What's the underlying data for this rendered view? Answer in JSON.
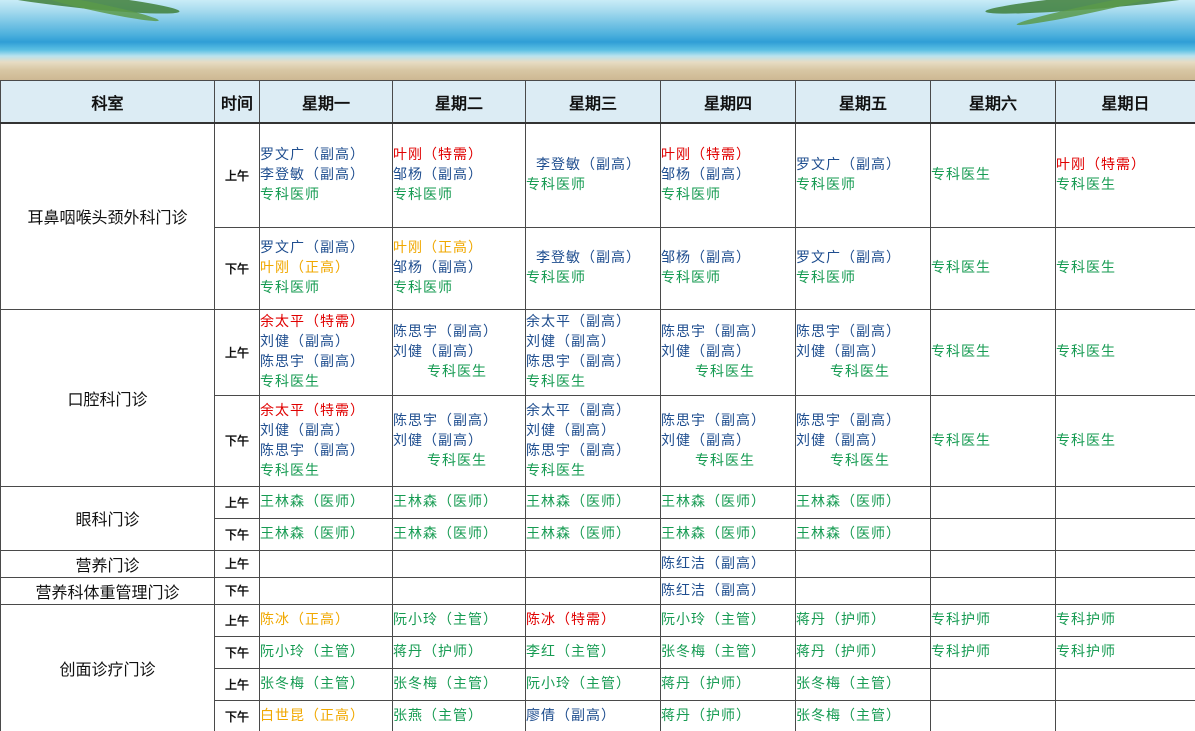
{
  "colors": {
    "blue": "#1f4e8f",
    "red": "#e00000",
    "orange": "#f0a800",
    "green": "#169b52",
    "header_bg": "#dcecf4"
  },
  "header": [
    "科室",
    "时间",
    "星期一",
    "星期二",
    "星期三",
    "星期四",
    "星期五",
    "星期六",
    "星期日"
  ],
  "rows": [
    {
      "dept": "耳鼻咽喉头颈外科门诊",
      "dept_rowspan": 2,
      "period": "上午",
      "height": 104,
      "cells": [
        [
          [
            "罗文广（副高）",
            "blue"
          ],
          [
            "李登敏（副高）",
            "blue"
          ],
          [
            "专科医师",
            "green"
          ]
        ],
        [
          [
            "叶刚（特需）",
            "red"
          ],
          [
            "邹杨（副高）",
            "blue"
          ],
          [
            "专科医师",
            "green"
          ]
        ],
        [
          [
            "李登敏（副高）",
            "blue",
            "ind"
          ],
          [
            "专科医师",
            "green"
          ]
        ],
        [
          [
            "叶刚（特需）",
            "red"
          ],
          [
            "邹杨（副高）",
            "blue"
          ],
          [
            "专科医师",
            "green"
          ]
        ],
        [
          [
            "罗文广（副高）",
            "blue"
          ],
          [
            "专科医师",
            "green"
          ]
        ],
        [
          [
            "专科医生",
            "green"
          ]
        ],
        [
          [
            "叶刚（特需）",
            "red"
          ],
          [
            "专科医生",
            "green"
          ]
        ]
      ]
    },
    {
      "period": "下午",
      "height": 82,
      "cells": [
        [
          [
            "罗文广（副高）",
            "blue"
          ],
          [
            "叶刚（正高）",
            "orange"
          ],
          [
            "专科医师",
            "green"
          ]
        ],
        [
          [
            "叶刚（正高）",
            "orange"
          ],
          [
            "邹杨（副高）",
            "blue"
          ],
          [
            "专科医师",
            "green"
          ]
        ],
        [
          [
            "李登敏（副高）",
            "blue",
            "ind"
          ],
          [
            "专科医师",
            "green"
          ]
        ],
        [
          [
            "邹杨（副高）",
            "blue"
          ],
          [
            "专科医师",
            "green"
          ]
        ],
        [
          [
            "罗文广（副高）",
            "blue"
          ],
          [
            "专科医师",
            "green"
          ]
        ],
        [
          [
            "专科医生",
            "green"
          ]
        ],
        [
          [
            "专科医生",
            "green"
          ]
        ]
      ]
    },
    {
      "dept": "口腔科门诊",
      "dept_rowspan": 2,
      "period": "上午",
      "height": 86,
      "cells": [
        [
          [
            "余太平（特需）",
            "red"
          ],
          [
            "刘健（副高）",
            "blue"
          ],
          [
            "陈思宇（副高）",
            "blue"
          ],
          [
            "专科医生",
            "green"
          ]
        ],
        [
          [
            "陈思宇（副高）",
            "blue"
          ],
          [
            "刘健（副高）",
            "blue"
          ],
          [
            "专科医生",
            "green",
            "ind2"
          ]
        ],
        [
          [
            "余太平（副高）",
            "blue"
          ],
          [
            "刘健（副高）",
            "blue"
          ],
          [
            "陈思宇（副高）",
            "blue"
          ],
          [
            "专科医生",
            "green"
          ]
        ],
        [
          [
            "陈思宇（副高）",
            "blue"
          ],
          [
            "刘健（副高）",
            "blue"
          ],
          [
            "专科医生",
            "green",
            "ind2"
          ]
        ],
        [
          [
            "陈思宇（副高）",
            "blue"
          ],
          [
            "刘健（副高）",
            "blue"
          ],
          [
            "专科医生",
            "green",
            "ind2"
          ]
        ],
        [
          [
            "专科医生",
            "green"
          ]
        ],
        [
          [
            "专科医生",
            "green"
          ]
        ]
      ]
    },
    {
      "period": "下午",
      "height": 91,
      "cells": [
        [
          [
            "余太平（特需）",
            "red"
          ],
          [
            "刘健（副高）",
            "blue"
          ],
          [
            "陈思宇（副高）",
            "blue"
          ],
          [
            "专科医生",
            "green"
          ]
        ],
        [
          [
            "陈思宇（副高）",
            "blue"
          ],
          [
            "刘健（副高）",
            "blue"
          ],
          [
            "专科医生",
            "green",
            "ind2"
          ]
        ],
        [
          [
            "余太平（副高）",
            "blue"
          ],
          [
            "刘健（副高）",
            "blue"
          ],
          [
            "陈思宇（副高）",
            "blue"
          ],
          [
            "专科医生",
            "green"
          ]
        ],
        [
          [
            "陈思宇（副高）",
            "blue"
          ],
          [
            "刘健（副高）",
            "blue"
          ],
          [
            "专科医生",
            "green",
            "ind2"
          ]
        ],
        [
          [
            "陈思宇（副高）",
            "blue"
          ],
          [
            "刘健（副高）",
            "blue"
          ],
          [
            "专科医生",
            "green",
            "ind2"
          ]
        ],
        [
          [
            "专科医生",
            "green"
          ]
        ],
        [
          [
            "专科医生",
            "green"
          ]
        ]
      ]
    },
    {
      "dept": "眼科门诊",
      "dept_rowspan": 2,
      "period": "上午",
      "height": 32,
      "cells": [
        [
          [
            "王林森（医师）",
            "green"
          ]
        ],
        [
          [
            "王林森（医师）",
            "green"
          ]
        ],
        [
          [
            "王林森（医师）",
            "green"
          ]
        ],
        [
          [
            "王林森（医师）",
            "green"
          ]
        ],
        [
          [
            "王林森（医师）",
            "green"
          ]
        ],
        [],
        []
      ]
    },
    {
      "period": "下午",
      "height": 32,
      "cells": [
        [
          [
            "王林森（医师）",
            "green"
          ]
        ],
        [
          [
            "王林森（医师）",
            "green"
          ]
        ],
        [
          [
            "王林森（医师）",
            "green"
          ]
        ],
        [
          [
            "王林森（医师）",
            "green"
          ]
        ],
        [
          [
            "王林森（医师）",
            "green"
          ]
        ],
        [],
        []
      ]
    },
    {
      "dept": "营养门诊",
      "dept_rowspan": 1,
      "period": "上午",
      "height": 27,
      "cells": [
        [],
        [],
        [],
        [
          [
            "陈红洁（副高）",
            "blue"
          ]
        ],
        [],
        [],
        []
      ]
    },
    {
      "dept": "营养科体重管理门诊",
      "dept_rowspan": 1,
      "period": "下午",
      "height": 27,
      "cells": [
        [],
        [],
        [],
        [
          [
            "陈红洁（副高）",
            "blue"
          ]
        ],
        [],
        [],
        []
      ]
    },
    {
      "dept": "创面诊疗门诊",
      "dept_rowspan": 4,
      "period": "上午",
      "height": 32,
      "cells": [
        [
          [
            "陈冰（正高）",
            "orange"
          ]
        ],
        [
          [
            "阮小玲（主管）",
            "green"
          ]
        ],
        [
          [
            "陈冰（特需）",
            "red"
          ]
        ],
        [
          [
            "阮小玲（主管）",
            "green"
          ]
        ],
        [
          [
            "蒋丹（护师）",
            "green"
          ]
        ],
        [
          [
            "专科护师",
            "green"
          ]
        ],
        [
          [
            "专科护师",
            "green"
          ]
        ]
      ]
    },
    {
      "period": "下午",
      "height": 32,
      "cells": [
        [
          [
            "阮小玲（主管）",
            "green"
          ]
        ],
        [
          [
            "蒋丹（护师）",
            "green"
          ]
        ],
        [
          [
            "李红（主管）",
            "green"
          ]
        ],
        [
          [
            "张冬梅（主管）",
            "green"
          ]
        ],
        [
          [
            "蒋丹（护师）",
            "green"
          ]
        ],
        [
          [
            "专科护师",
            "green"
          ]
        ],
        [
          [
            "专科护师",
            "green"
          ]
        ]
      ]
    },
    {
      "period": "上午",
      "height": 32,
      "cells": [
        [
          [
            "张冬梅（主管）",
            "green"
          ]
        ],
        [
          [
            "张冬梅（主管）",
            "green"
          ]
        ],
        [
          [
            "阮小玲（主管）",
            "green"
          ]
        ],
        [
          [
            "蒋丹（护师）",
            "green"
          ]
        ],
        [
          [
            "张冬梅（主管）",
            "green"
          ]
        ],
        [],
        []
      ]
    },
    {
      "period": "下午",
      "height": 32,
      "cells": [
        [
          [
            "白世昆（正高）",
            "orange"
          ]
        ],
        [
          [
            "张燕（主管）",
            "green"
          ]
        ],
        [
          [
            "廖倩（副高）",
            "blue"
          ]
        ],
        [
          [
            "蒋丹（护师）",
            "green"
          ]
        ],
        [
          [
            "张冬梅（主管）",
            "green"
          ]
        ],
        [],
        []
      ]
    }
  ]
}
